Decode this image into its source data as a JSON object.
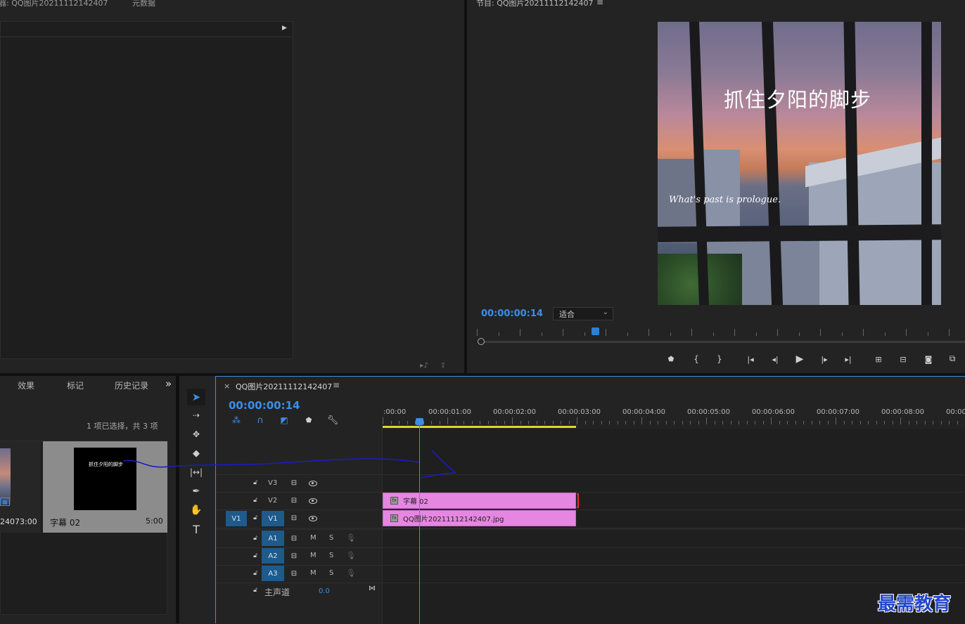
{
  "source_panel": {
    "title": "器: QQ图片20211112142407",
    "metadata_tab": "元数据",
    "play_arrow": "▶"
  },
  "program_panel": {
    "title": "节目: QQ图片20211112142407",
    "menu_icon": "≡",
    "timecode": "00:00:00:14",
    "fit_label": "适合",
    "video_title_overlay": "抓住夕阳的脚步",
    "video_subtitle_overlay": "What's past is prologue."
  },
  "project_panel": {
    "tabs": [
      "效果",
      "标记",
      "历史记录"
    ],
    "more": "»",
    "selection_info": "1 项已选择，共 3 项",
    "items": [
      {
        "name": "2407",
        "duration": "3:00"
      },
      {
        "name": "字幕 02",
        "duration": "5:00",
        "thumb_text": "抓住夕阳的脚步"
      }
    ]
  },
  "timeline": {
    "close": "×",
    "title": "QQ图片20211112142407",
    "menu_icon": "≡",
    "timecode": "00:00:00:14",
    "ruler": [
      ":00:00",
      "00:00:01:00",
      "00:00:02:00",
      "00:00:03:00",
      "00:00:04:00",
      "00:00:05:00",
      "00:00:06:00",
      "00:00:07:00",
      "00:00:08:00",
      "00:00"
    ],
    "video_tracks": [
      "V3",
      "V2",
      "V1"
    ],
    "source_patch": "V1",
    "audio_tracks": [
      "A1",
      "A2",
      "A3"
    ],
    "mute": "M",
    "solo": "S",
    "master_label": "主声道",
    "master_value": "0.0",
    "clips": {
      "title_clip": "字幕 02",
      "image_clip": "QQ图片20211112142407.jpg"
    }
  },
  "tools": [
    "selection",
    "track-select",
    "ripple-edit",
    "razor",
    "slip",
    "pen",
    "hand",
    "type"
  ],
  "watermark": "最需教育",
  "colors": {
    "accent_blue": "#3b8ee8",
    "clip_pink": "#e587e0",
    "work_area_yellow": "#d9d43a",
    "annotation": "#1c1cc0"
  }
}
